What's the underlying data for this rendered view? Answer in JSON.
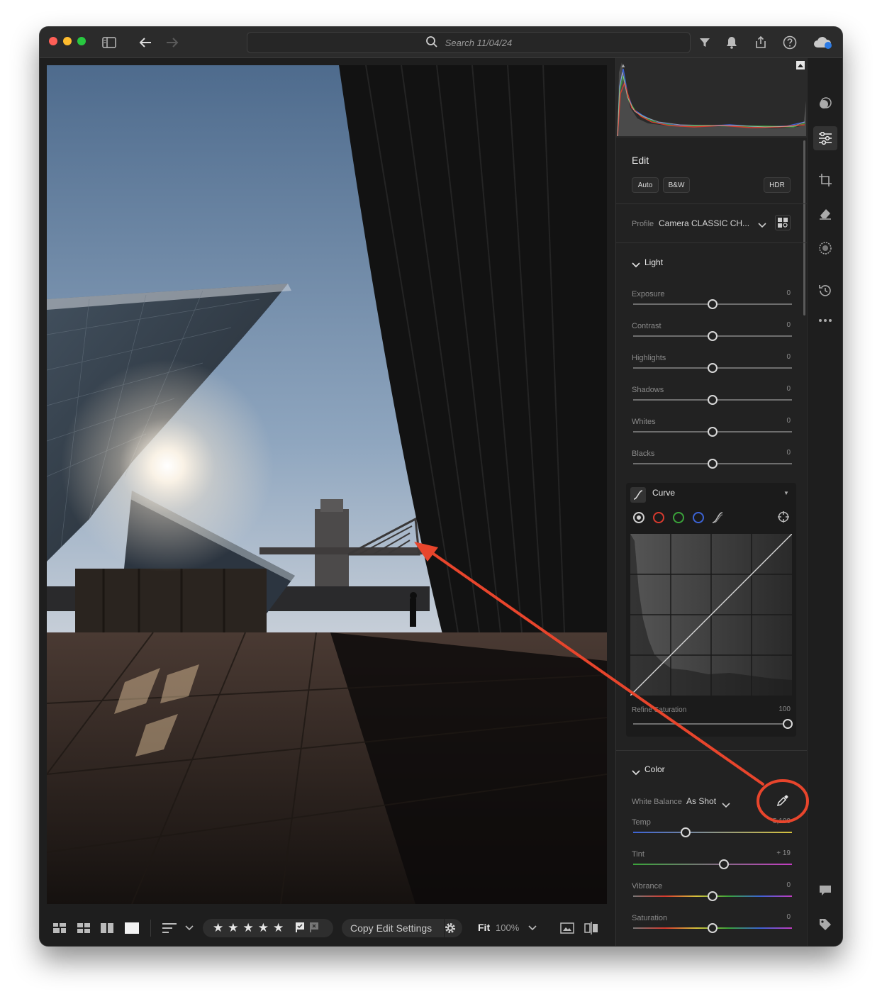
{
  "titlebar": {
    "search_placeholder": "Search 11/04/24",
    "icons": [
      "sidebar-toggle-icon",
      "back-arrow-icon",
      "forward-arrow-icon",
      "search-icon",
      "filter-icon",
      "bell-icon",
      "share-icon",
      "help-icon",
      "cloud-sync-icon"
    ]
  },
  "edit": {
    "title": "Edit",
    "auto_label": "Auto",
    "bw_label": "B&W",
    "hdr_label": "HDR",
    "profile_label": "Profile",
    "profile_value": "Camera CLASSIC CH..."
  },
  "light": {
    "title": "Light",
    "sliders": [
      {
        "label": "Exposure",
        "value": "0",
        "level": 0.5
      },
      {
        "label": "Contrast",
        "value": "0",
        "level": 0.5
      },
      {
        "label": "Highlights",
        "value": "0",
        "level": 0.5
      },
      {
        "label": "Shadows",
        "value": "0",
        "level": 0.5
      },
      {
        "label": "Whites",
        "value": "0",
        "level": 0.5
      },
      {
        "label": "Blacks",
        "value": "0",
        "level": 0.5
      }
    ]
  },
  "curve": {
    "title": "Curve",
    "refine_label": "Refine Saturation",
    "refine_value": "100",
    "refine_level": 1.0,
    "channel_colors": [
      "#d0d0d0",
      "#d83a2e",
      "#3aa33a",
      "#3c63d6"
    ]
  },
  "color": {
    "title": "Color",
    "wb_label": "White Balance",
    "wb_value": "As Shot",
    "sliders": [
      {
        "label": "Temp",
        "value": "5,100",
        "level": 0.33
      },
      {
        "label": "Tint",
        "value": "+ 19",
        "level": 0.57
      },
      {
        "label": "Vibrance",
        "value": "0",
        "level": 0.5
      },
      {
        "label": "Saturation",
        "value": "0",
        "level": 0.5
      }
    ]
  },
  "bottombar": {
    "copy_label": "Copy Edit Settings",
    "fit_label": "Fit",
    "zoom_label": "100%",
    "rating_stars": 5
  },
  "annotation": {
    "color": "#e8452c"
  }
}
